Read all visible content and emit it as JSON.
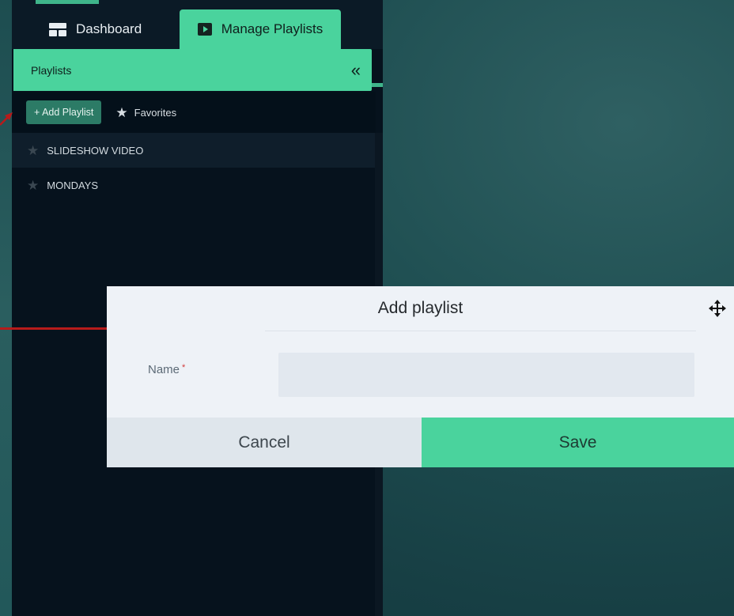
{
  "nav": {
    "tabs": [
      {
        "label": "Dashboard",
        "icon": "dashboard-icon",
        "active": false
      },
      {
        "label": "Manage Playlists",
        "icon": "playlist-icon",
        "active": true
      }
    ]
  },
  "sidebar": {
    "header_title": "Playlists",
    "collapse_symbol": "«",
    "add_button_label": "+ Add Playlist",
    "favorites_label": "Favorites",
    "items": [
      {
        "label": "SLIDESHOW VIDEO",
        "favorite": false,
        "selected": true
      },
      {
        "label": "MONDAYS",
        "favorite": false,
        "selected": false
      }
    ]
  },
  "modal": {
    "title": "Add playlist",
    "name_label": "Name",
    "required_marker": "*",
    "name_value": "",
    "cancel_label": "Cancel",
    "save_label": "Save"
  },
  "colors": {
    "accent": "#4ad39d",
    "panel_bg": "#06121d",
    "annotation_arrow": "#b71b1b"
  }
}
